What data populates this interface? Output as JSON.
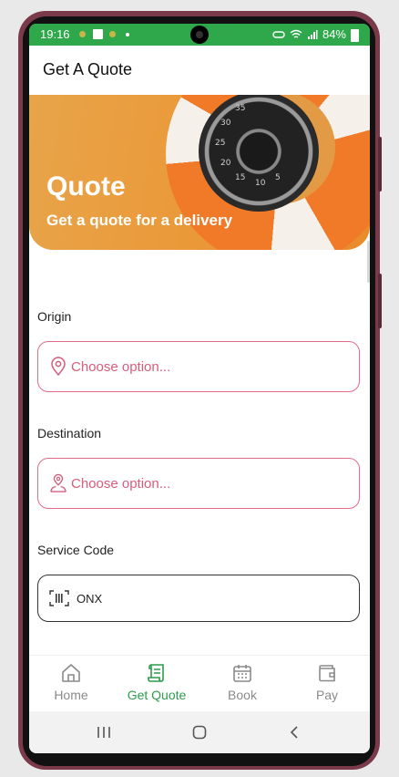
{
  "status_bar": {
    "time": "19:16",
    "battery": "84%"
  },
  "header": {
    "title": "Get A Quote"
  },
  "banner": {
    "title": "Quote",
    "subtitle": "Get a quote for a delivery",
    "dial_numbers": [
      "35",
      "30",
      "25",
      "20",
      "15",
      "10",
      "5"
    ]
  },
  "form": {
    "origin": {
      "label": "Origin",
      "placeholder": "Choose option..."
    },
    "destination": {
      "label": "Destination",
      "placeholder": "Choose option..."
    },
    "service_code": {
      "label": "Service Code",
      "value": "ONX"
    }
  },
  "bottom_nav": {
    "items": [
      {
        "label": "Home",
        "icon": "home-icon"
      },
      {
        "label": "Get Quote",
        "icon": "quote-scroll-icon",
        "active": true
      },
      {
        "label": "Book",
        "icon": "calendar-icon"
      },
      {
        "label": "Pay",
        "icon": "wallet-icon"
      }
    ]
  },
  "colors": {
    "status_bar": "#2ea84a",
    "accent": "#2d9c4c",
    "field_border": "#e46a86",
    "placeholder": "#d65d7c"
  }
}
